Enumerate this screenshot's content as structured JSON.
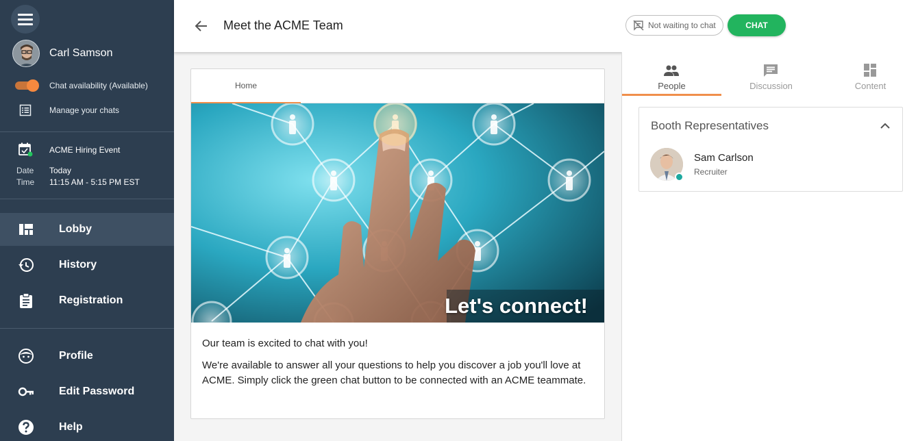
{
  "sidebar": {
    "user": {
      "name": "Carl Samson"
    },
    "availability_label": "Chat availability (Available)",
    "manage_label": "Manage your chats",
    "event": {
      "title": "ACME Hiring Event",
      "date_key": "Date",
      "date_value": "Today",
      "time_key": "Time",
      "time_value": "11:15 AM - 5:15 PM EST"
    },
    "nav": [
      {
        "label": "Lobby",
        "icon": "dashboard-icon",
        "active": true
      },
      {
        "label": "History",
        "icon": "history-icon"
      },
      {
        "label": "Registration",
        "icon": "clipboard-icon"
      },
      {
        "label": "Profile",
        "icon": "face-icon"
      },
      {
        "label": "Edit Password",
        "icon": "key-icon"
      },
      {
        "label": "Help",
        "icon": "help-icon"
      }
    ]
  },
  "header": {
    "title": "Meet the ACME Team",
    "not_waiting_label": "Not waiting to chat",
    "chat_button": "CHAT"
  },
  "main": {
    "tab": "Home",
    "hero_caption": "Let's connect!",
    "intro": "Our team is excited to chat with you!",
    "body": "We're available to answer all your questions to help you discover a job you'll love at ACME. Simply click the green chat button to be connected with an ACME teammate."
  },
  "right": {
    "tabs": [
      {
        "label": "People",
        "active": true
      },
      {
        "label": "Discussion"
      },
      {
        "label": "Content"
      }
    ],
    "reps_title": "Booth Representatives",
    "rep": {
      "name": "Sam Carlson",
      "role": "Recruiter"
    }
  },
  "colors": {
    "sidebar_bg": "#2d3e50",
    "accent_orange": "#f08f4b",
    "chat_green": "#22b45e",
    "online_teal": "#1ea9a0"
  }
}
